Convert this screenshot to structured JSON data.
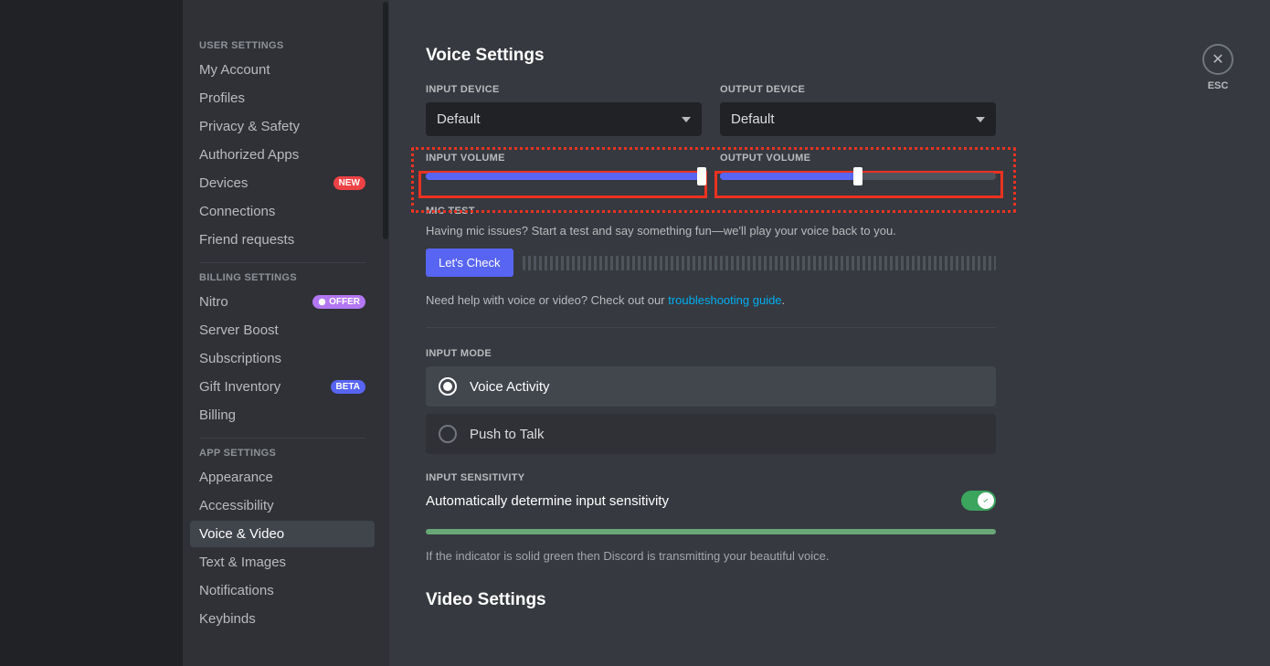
{
  "sidebar": {
    "sections": [
      {
        "header": "USER SETTINGS",
        "items": [
          {
            "label": "My Account"
          },
          {
            "label": "Profiles"
          },
          {
            "label": "Privacy & Safety"
          },
          {
            "label": "Authorized Apps"
          },
          {
            "label": "Devices",
            "badge": "NEW",
            "badgeType": "new"
          },
          {
            "label": "Connections"
          },
          {
            "label": "Friend requests"
          }
        ]
      },
      {
        "header": "BILLING SETTINGS",
        "items": [
          {
            "label": "Nitro",
            "badge": "OFFER",
            "badgeType": "offer"
          },
          {
            "label": "Server Boost"
          },
          {
            "label": "Subscriptions"
          },
          {
            "label": "Gift Inventory",
            "badge": "BETA",
            "badgeType": "beta"
          },
          {
            "label": "Billing"
          }
        ]
      },
      {
        "header": "APP SETTINGS",
        "items": [
          {
            "label": "Appearance"
          },
          {
            "label": "Accessibility"
          },
          {
            "label": "Voice & Video",
            "selected": true
          },
          {
            "label": "Text & Images"
          },
          {
            "label": "Notifications"
          },
          {
            "label": "Keybinds"
          }
        ]
      }
    ]
  },
  "page": {
    "title": "Voice Settings",
    "close_label": "ESC",
    "input_device": {
      "label": "INPUT DEVICE",
      "value": "Default"
    },
    "output_device": {
      "label": "OUTPUT DEVICE",
      "value": "Default"
    },
    "input_volume": {
      "label": "INPUT VOLUME",
      "percent": 100
    },
    "output_volume": {
      "label": "OUTPUT VOLUME",
      "percent": 50
    },
    "mic_test": {
      "label": "MIC TEST",
      "desc": "Having mic issues? Start a test and say something fun—we'll play your voice back to you.",
      "button": "Let's Check"
    },
    "help": {
      "prefix": "Need help with voice or video? Check out our ",
      "link": "troubleshooting guide",
      "suffix": "."
    },
    "input_mode": {
      "label": "INPUT MODE",
      "options": [
        {
          "label": "Voice Activity",
          "selected": true
        },
        {
          "label": "Push to Talk",
          "selected": false
        }
      ]
    },
    "sensitivity": {
      "label": "INPUT SENSITIVITY",
      "auto_text": "Automatically determine input sensitivity",
      "toggle_on": true,
      "note": "If the indicator is solid green then Discord is transmitting your beautiful voice."
    },
    "video_title": "Video Settings"
  }
}
